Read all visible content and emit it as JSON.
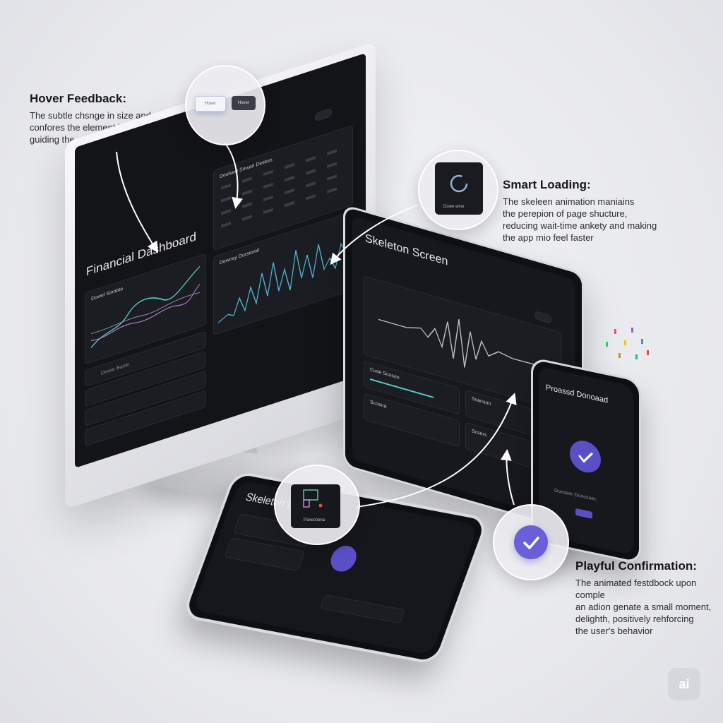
{
  "callouts": {
    "hover": {
      "title": "Hover Feedback:",
      "lines": [
        "The subtle chsnge in size and shadow",
        "confores the element is clickable,",
        "guiding the user without distraction."
      ]
    },
    "loading": {
      "title": "Smart Loading:",
      "lines": [
        "The skeleen animation maniains",
        "the perepion of page shucture,",
        "reducing wait-time ankety and making",
        "the app mio feel faster"
      ]
    },
    "confirm": {
      "title": "Playful Confirmation:",
      "lines": [
        "The animated festdbock upon comple",
        "an adion genate a small moment,",
        "delighth, positively rehforcing",
        "the user's behavior"
      ]
    }
  },
  "magnifiers": {
    "hover": {
      "button_a": "Hover",
      "button_b": "Hover"
    },
    "loading": {
      "label": "Dowe wine"
    },
    "skeleton": {
      "label": "Panectiona"
    }
  },
  "monitor": {
    "title": "Financial Dashboard",
    "chart1_label": "Dowel Sinnbte",
    "chart2_label": "Dewnsy Dorsiomil",
    "table_header": "Deelvert Snwan Deskes",
    "section_label": "Dewar Banie"
  },
  "tablet": {
    "title": "Skeleton Screen",
    "card1": "Cuse Scoson",
    "card2": "Scanson",
    "card3": "Scosna",
    "card4": "Scsers"
  },
  "phone_lying": {
    "title": "Skeleton Dashboard"
  },
  "phone_stand": {
    "title": "Proassd Donoaad",
    "button": "Dueseer Dunosaec"
  },
  "watermark": "ai",
  "colors": {
    "accent_purple": "#5b4fc7",
    "chart_teal": "#4fd1c5",
    "screen_bg": "#131418"
  }
}
